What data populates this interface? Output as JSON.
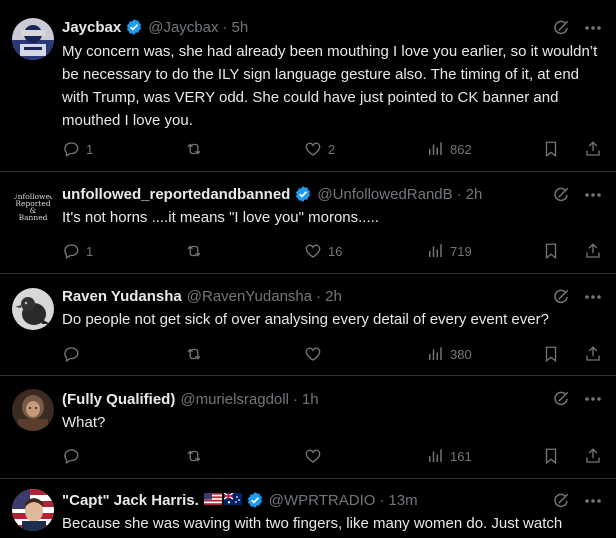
{
  "posts": [
    {
      "avatar": "avatar-jaycbax",
      "name": "Jaycbax",
      "verified": true,
      "handle": "@Jaycbax",
      "time": "5h",
      "text": "My concern was, she had already been mouthing I love you earlier, so it wouldn’t be necessary to do the ILY sign language gesture also. The timing of it, at end with Trump, was VERY odd. She could have just pointed to CK banner and mouthed I love you.",
      "replies": "1",
      "reposts": "",
      "likes": "2",
      "views": "862"
    },
    {
      "avatar": "avatar-unfollowed",
      "avatar_text": "Unfollowed\nReported &\nBanned",
      "name": "unfollowed_reportedandbanned",
      "verified": true,
      "handle": "@UnfollowedRandB",
      "time": "2h",
      "text": "It's not horns ....it means \"I love you\" morons.....",
      "replies": "1",
      "reposts": "",
      "likes": "16",
      "views": "719"
    },
    {
      "avatar": "avatar-raven",
      "name": "Raven Yudansha",
      "verified": false,
      "handle": "@RavenYudansha",
      "time": "2h",
      "text": "Do people not get sick of over analysing every detail of every event ever?",
      "replies": "",
      "reposts": "",
      "likes": "",
      "views": "380"
    },
    {
      "avatar": "avatar-muriel",
      "name": "(Fully Qualified)",
      "verified": false,
      "handle": "@murielsragdoll",
      "time": "1h",
      "text": "What?",
      "replies": "",
      "reposts": "",
      "likes": "",
      "views": "161"
    },
    {
      "avatar": "avatar-capt",
      "name": "\"Capt\" Jack Harris.",
      "verified": true,
      "flags": [
        "us-flag",
        "au-flag"
      ],
      "handle": "@WPRTRADIO",
      "time": "13m",
      "text": "Because she was waving with two fingers, like many women do. Just watch",
      "replies": "",
      "reposts": "",
      "likes": "",
      "views": ""
    }
  ],
  "colors": {
    "background": "#000000",
    "text": "#e7e9ea",
    "muted": "#71767b",
    "divider": "#2f3336",
    "verified": "#1d9bf0"
  },
  "separator": "·"
}
